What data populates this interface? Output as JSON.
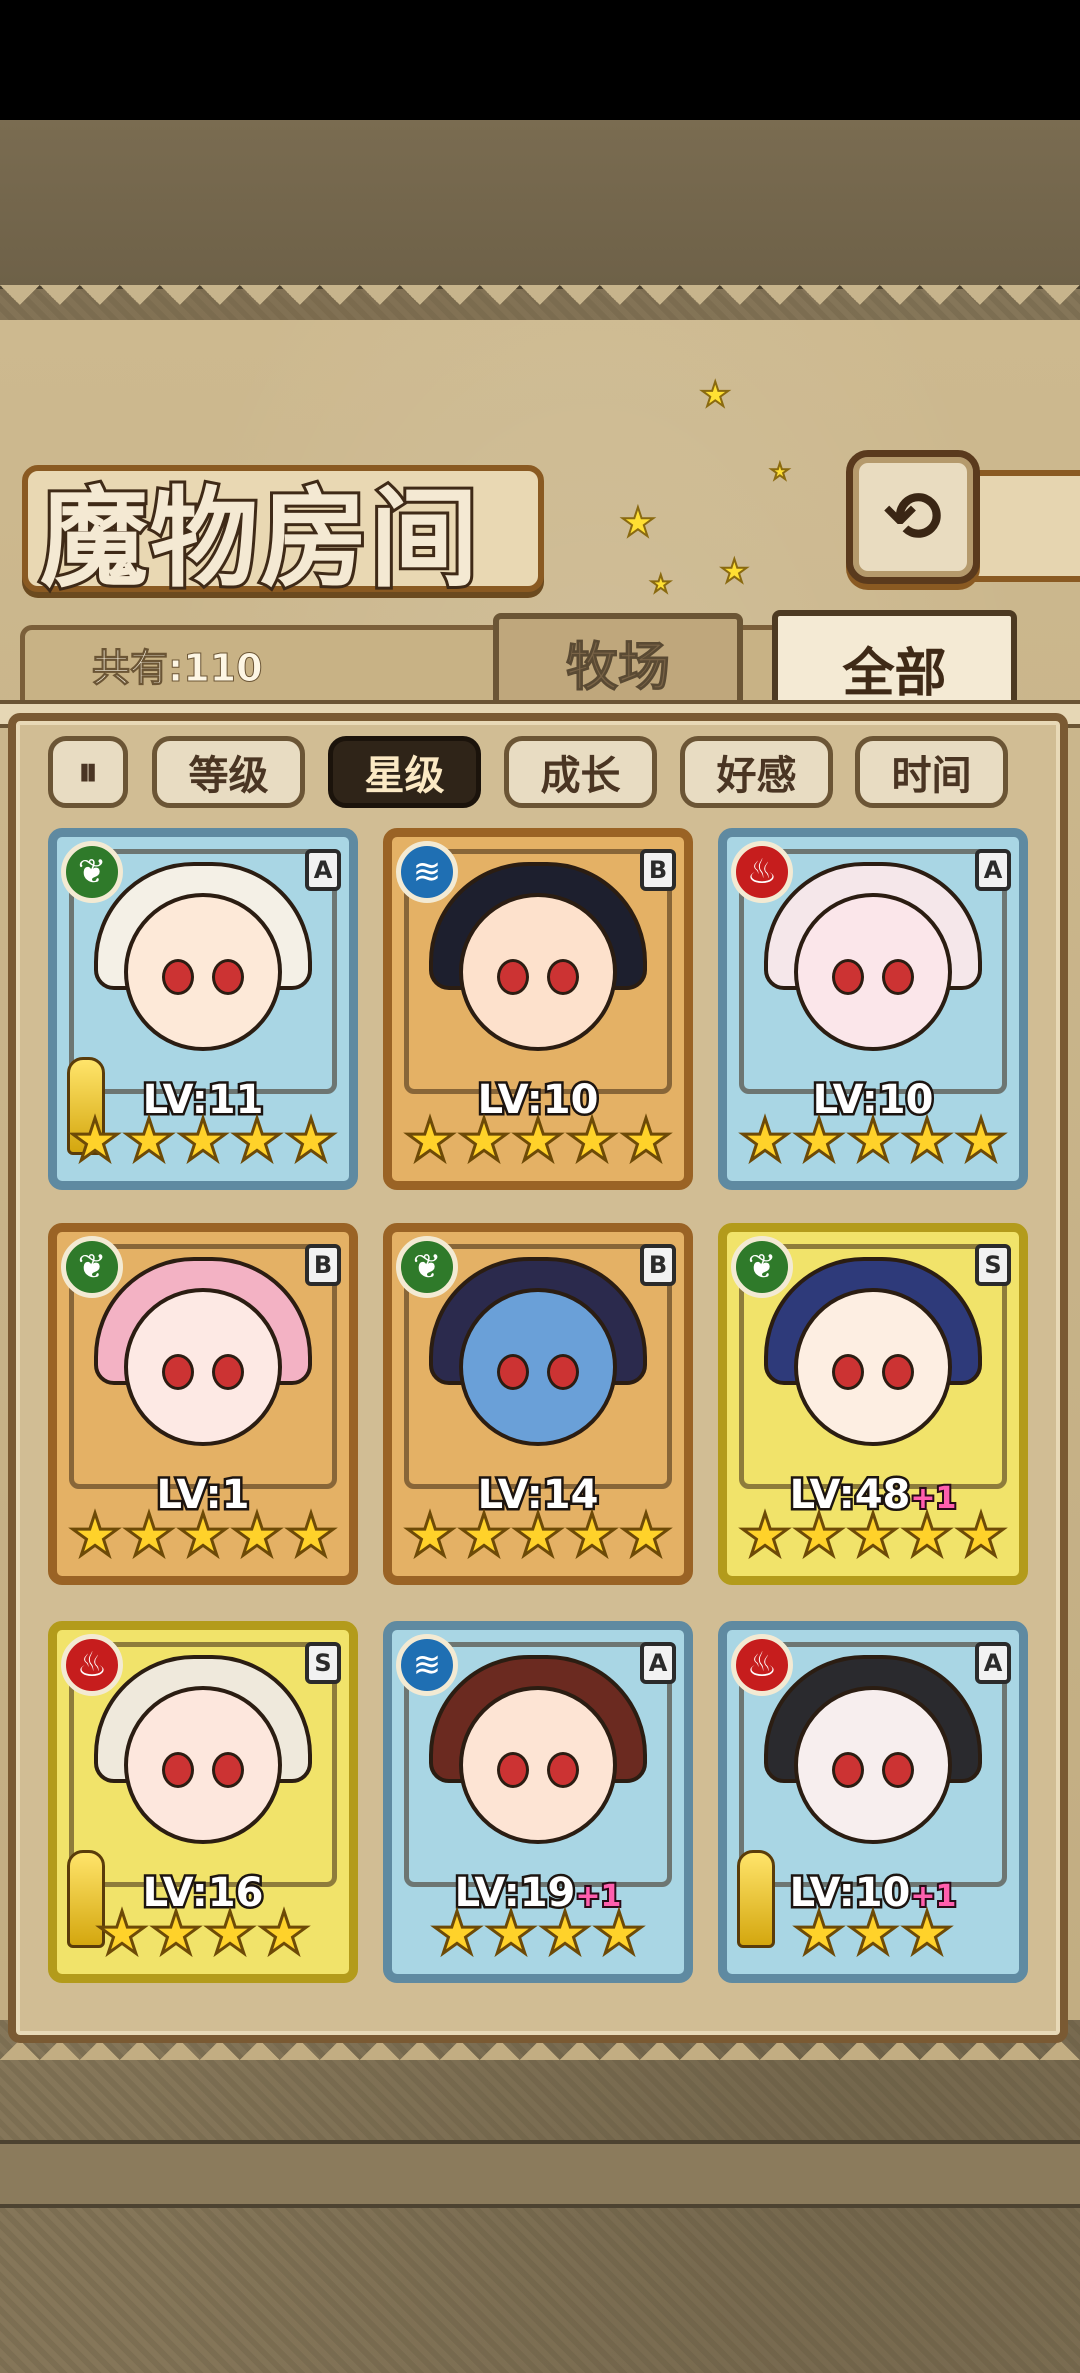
{
  "header": {
    "title": "魔物房间",
    "back_icon": "⟲",
    "count_label": "共有:110"
  },
  "tabs": [
    {
      "label": "牧场",
      "active": false
    },
    {
      "label": "全部",
      "active": true
    }
  ],
  "sort": {
    "pause_icon": "⏸",
    "buttons": [
      {
        "label": "等级",
        "selected": false
      },
      {
        "label": "星级",
        "selected": true
      },
      {
        "label": "成长",
        "selected": false
      },
      {
        "label": "好感",
        "selected": false
      },
      {
        "label": "时间",
        "selected": false
      }
    ]
  },
  "monsters": [
    {
      "element": "leaf",
      "rank": "A",
      "frame": "blue",
      "level": "LV:11",
      "plus": "",
      "stars": 5,
      "weapon": true,
      "hair": "#f4f0e6",
      "skin": "#fde9d8"
    },
    {
      "element": "water",
      "rank": "B",
      "frame": "orange",
      "level": "LV:10",
      "plus": "",
      "stars": 5,
      "weapon": false,
      "hair": "#1d1f2e",
      "skin": "#fde1cc"
    },
    {
      "element": "fire",
      "rank": "A",
      "frame": "blue",
      "level": "LV:10",
      "plus": "",
      "stars": 5,
      "weapon": false,
      "hair": "#f5e7ea",
      "skin": "#fbe6ea"
    },
    {
      "element": "leaf",
      "rank": "B",
      "frame": "orange",
      "level": "LV:1",
      "plus": "",
      "stars": 5,
      "weapon": false,
      "hair": "#f3b2c4",
      "skin": "#fde9e4"
    },
    {
      "element": "leaf",
      "rank": "B",
      "frame": "orange",
      "level": "LV:14",
      "plus": "",
      "stars": 5,
      "weapon": false,
      "hair": "#2b2a4d",
      "skin": "#6aa0d8"
    },
    {
      "element": "leaf",
      "rank": "S",
      "frame": "gold",
      "level": "LV:48",
      "plus": "+1",
      "stars": 5,
      "weapon": false,
      "hair": "#2e3a7a",
      "skin": "#fdeee2"
    },
    {
      "element": "fire",
      "rank": "S",
      "frame": "gold",
      "level": "LV:16",
      "plus": "",
      "stars": 4,
      "weapon": true,
      "hair": "#efe9dc",
      "skin": "#fde7dd"
    },
    {
      "element": "water",
      "rank": "A",
      "frame": "blue",
      "level": "LV:19",
      "plus": "+1",
      "stars": 4,
      "weapon": false,
      "hair": "#6b2a20",
      "skin": "#fde4d4"
    },
    {
      "element": "fire",
      "rank": "A",
      "frame": "blue",
      "level": "LV:10",
      "plus": "+1",
      "stars": 3,
      "weapon": true,
      "hair": "#2a2a2e",
      "skin": "#f7eeee"
    }
  ],
  "element_icons": {
    "leaf": "❦",
    "water": "≋",
    "fire": "♨"
  },
  "star_glyph": "★"
}
